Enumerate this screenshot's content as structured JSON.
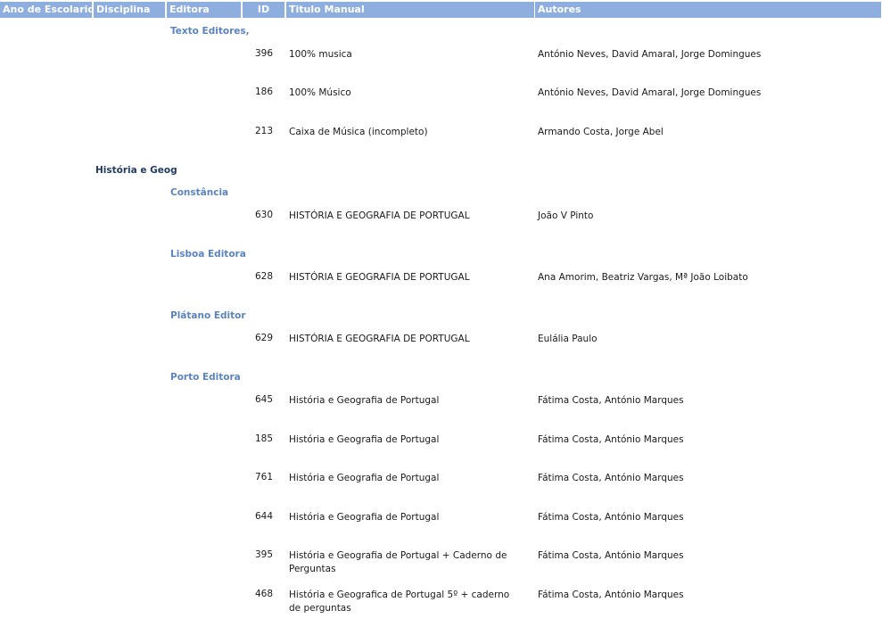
{
  "headers": {
    "ano": "Ano de Escolaridade",
    "disciplina": "Disciplina",
    "editora": "Editora",
    "id": "ID",
    "titulo": "Titulo Manual",
    "autores": "Autores"
  },
  "disciplines": [
    "História e Geog"
  ],
  "publishers": [
    "Texto Editores,",
    "Constância",
    "Lisboa Editora",
    "Plátano Editor",
    "Porto Editora"
  ],
  "rows": [
    {
      "id": "396",
      "title": "100% musica",
      "authors": "António Neves, David Amaral, Jorge Domingues"
    },
    {
      "id": "186",
      "title": "100% Músico",
      "authors": "António Neves, David Amaral, Jorge Domingues"
    },
    {
      "id": "213",
      "title": "Caixa de Música (incompleto)",
      "authors": "Armando Costa, Jorge Abel"
    },
    {
      "id": "630",
      "title": "HISTÓRIA E GEOGRAFIA DE PORTUGAL",
      "authors": "João V Pinto"
    },
    {
      "id": "628",
      "title": "HISTÓRIA E GEOGRAFIA DE PORTUGAL",
      "authors": "Ana Amorim, Beatriz Vargas, Mª João Loibato"
    },
    {
      "id": "629",
      "title": "HISTÓRIA E GEOGRAFIA DE PORTUGAL",
      "authors": "Eulália Paulo"
    },
    {
      "id": "645",
      "title": "História e Geografia de Portugal",
      "authors": "Fátima Costa, António Marques"
    },
    {
      "id": "185",
      "title": "História e Geografia de Portugal",
      "authors": "Fátima Costa, António Marques"
    },
    {
      "id": "761",
      "title": "História e Geografia de Portugal",
      "authors": "Fátima Costa, António Marques"
    },
    {
      "id": "644",
      "title": "História e Geografia de Portugal",
      "authors": "Fátima Costa, António Marques"
    },
    {
      "id": "395",
      "title": "História e Geografia de Portugal + Caderno de Perguntas",
      "authors": "Fátima Costa, António Marques"
    },
    {
      "id": "468",
      "title": "História e Geografica de Portugal 5º + caderno de perguntas",
      "authors": "Fátima Costa, António Marques"
    }
  ]
}
